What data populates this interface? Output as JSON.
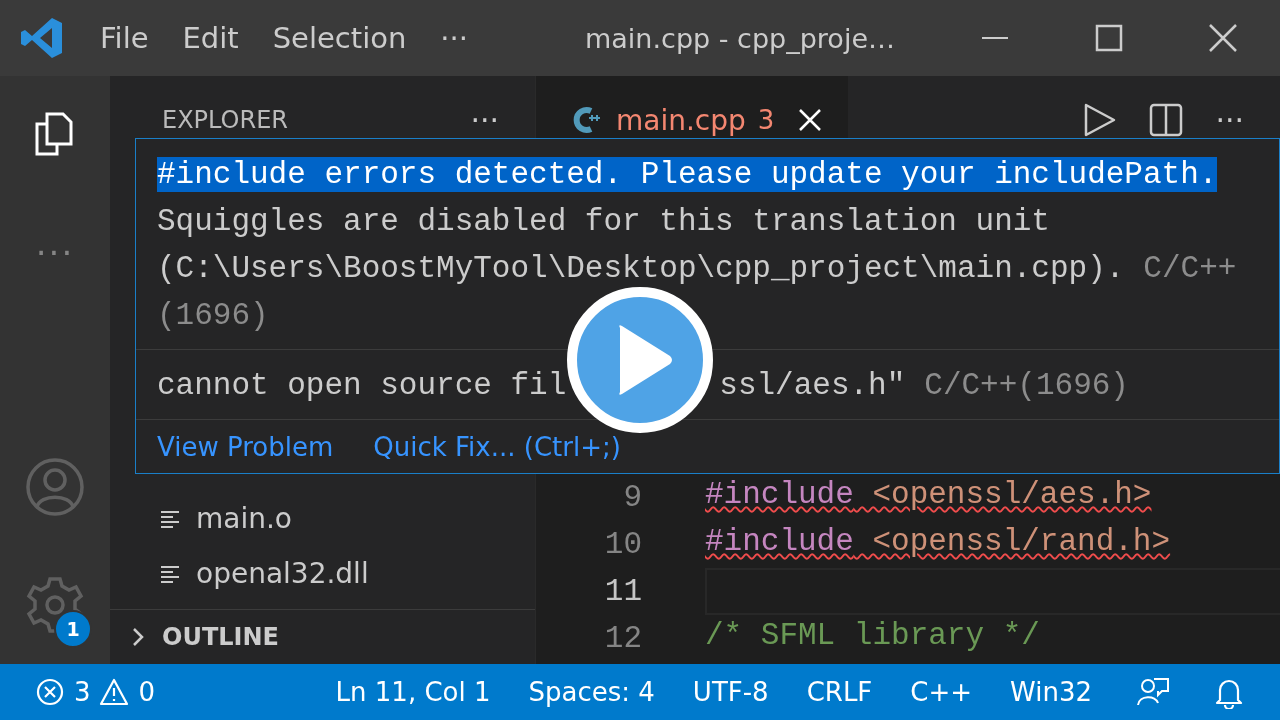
{
  "title_bar": {
    "menu": [
      "File",
      "Edit",
      "Selection"
    ],
    "more": "···",
    "title": "main.cpp - cpp_proje…"
  },
  "activity_bar": {
    "top": [
      {
        "kind": "files",
        "selected": true
      },
      {
        "kind": "more"
      }
    ],
    "bottom": [
      {
        "kind": "account"
      },
      {
        "kind": "settings",
        "badge": "1"
      }
    ],
    "more_text": "···"
  },
  "sidebar": {
    "title": "EXPLORER",
    "actions": "···",
    "files": [
      "main.o",
      "openal32.dll"
    ],
    "sections": [
      {
        "label": "OUTLINE",
        "expanded": false
      }
    ]
  },
  "editor": {
    "tabs": [
      {
        "label": "main.cpp",
        "problems": "3",
        "selected": true
      }
    ],
    "actions_more": "···",
    "lines": [
      {
        "number": "9",
        "current": false,
        "tokens": [
          {
            "kind": "directive",
            "text": "#include"
          },
          {
            "kind": "string",
            "text": " <openssl/aes.h>"
          }
        ],
        "squiggle": true
      },
      {
        "number": "10",
        "current": false,
        "tokens": [
          {
            "kind": "directive",
            "text": "#include"
          },
          {
            "kind": "string",
            "text": " <openssl/rand.h>"
          }
        ],
        "squiggle": true
      },
      {
        "number": "11",
        "current": true
      },
      {
        "number": "12",
        "current": false,
        "tokens": [
          {
            "kind": "comment",
            "text": "/* SFML library */"
          }
        ],
        "squiggle": false
      }
    ]
  },
  "hover": {
    "problems": [
      {
        "lines": [
          {
            "selected": true,
            "segments": [
              {
                "kind": "text",
                "text": "#include errors detected. Please update your includePath."
              }
            ]
          },
          {
            "selected": false,
            "segments": [
              {
                "kind": "text",
                "text": "Squiggles are disabled for this translation unit"
              }
            ]
          },
          {
            "selected": false,
            "segments": [
              {
                "kind": "text",
                "text": "(C:\\Users\\BoostMyTool\\Desktop\\cpp_project\\main.cpp)."
              },
              {
                "kind": "muted",
                "text": "C/C++"
              }
            ]
          },
          {
            "selected": false,
            "segments": [
              {
                "kind": "muted",
                "text": "(1696)"
              }
            ]
          }
        ]
      },
      {
        "lines": [
          {
            "selected": false,
            "segments": [
              {
                "kind": "text",
                "text": "cannot open source fil"
              },
              {
                "kind": "cut",
                "text": "ssl/aes.h\""
              },
              {
                "kind": "muted",
                "text": "C/C++(1696)"
              }
            ]
          }
        ]
      }
    ],
    "actions": [
      "View Problem",
      "Quick Fix... (Ctrl+;)"
    ]
  },
  "status_bar": {
    "errors": "3",
    "warnings": "0",
    "items": [
      "Ln 11, Col 1",
      "Spaces: 4",
      "UTF-8",
      "CRLF",
      "C++",
      "Win32"
    ]
  }
}
